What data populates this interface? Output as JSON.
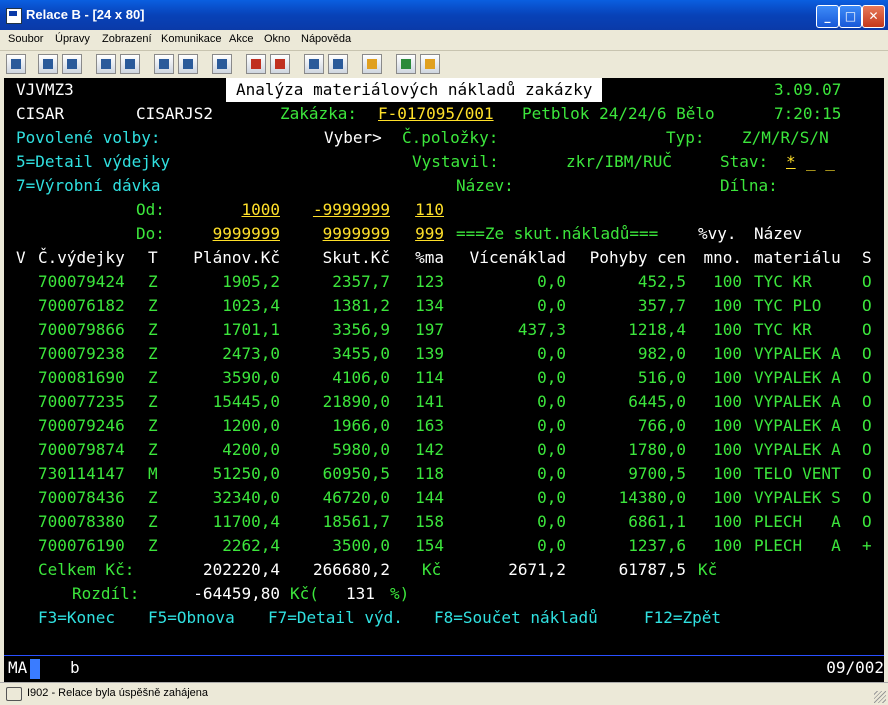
{
  "window": {
    "title": "Relace B - [24 x 80]",
    "minimize": "_",
    "maximize": "□",
    "close": "✕"
  },
  "menu": [
    "Soubor",
    "Úpravy",
    "Zobrazení",
    "Komunikace",
    "Akce",
    "Okno",
    "Nápověda"
  ],
  "toolbar_icons": [
    "print-screen-icon",
    "copy-icon",
    "paste-icon",
    "send-icon",
    "receive-icon",
    "display-icon",
    "keyboard-icon",
    "macro-icon",
    "record-icon",
    "playback-icon",
    "stop-icon",
    "clip-icon",
    "help-globe-icon",
    "customize-icon"
  ],
  "screen": {
    "program": "VJVMZ3",
    "title": "Analýza materiálových nákladů zakázky",
    "date": "3.09.07",
    "user": "CISAR",
    "device": "CISARJS2",
    "order_label": "Zakázka:",
    "order_value": "F-017095/001",
    "order_desc": "Petblok 24/24/6 Bělo",
    "time": "7:20:15",
    "allowed_options": "Povolené volby:",
    "select_label": "Vyber>",
    "item_no_label": "Č.položky:",
    "item_no_value": "",
    "type_label": "Typ:",
    "type_value": "",
    "type_options": "Z/M/R/S/N",
    "option5": "5=Detail výdejky",
    "issuer_label": "Vystavil:",
    "issuer_value": "",
    "issuer_options": "zkr/IBM/RUČ",
    "state_label": "Stav:",
    "state_value": "*",
    "option7": "7=Výrobní dávka",
    "name_label": "Název:",
    "name_value": "",
    "workshop_label": "Dílna:",
    "workshop_value": "",
    "from_label": "Od:",
    "from_plan": "1000",
    "from_actual": "-9999999",
    "from_pct": "110",
    "to_label": "Do:",
    "to_plan": "9999999",
    "to_actual": "9999999",
    "to_pct": "999",
    "actual_costs_note": "===Ze skut.nákladů===",
    "col_pct_header": "%vy.",
    "col_name_header": "Název"
  },
  "table": {
    "headers": [
      "V",
      "Č.výdejky",
      "T",
      "Plánov.Kč",
      "Skut.Kč",
      "%ma",
      "Vícenáklad",
      "Pohyby cen",
      "mno.",
      "materiálu",
      "S"
    ],
    "rows": [
      [
        "",
        "700079424",
        "Z",
        "1905,2",
        "2357,7",
        "123",
        "0,0",
        "452,5",
        "100",
        "TYC KR",
        "O"
      ],
      [
        "",
        "700076182",
        "Z",
        "1023,4",
        "1381,2",
        "134",
        "0,0",
        "357,7",
        "100",
        "TYC PLO",
        "O"
      ],
      [
        "",
        "700079866",
        "Z",
        "1701,1",
        "3356,9",
        "197",
        "437,3",
        "1218,4",
        "100",
        "TYC KR",
        "O"
      ],
      [
        "",
        "700079238",
        "Z",
        "2473,0",
        "3455,0",
        "139",
        "0,0",
        "982,0",
        "100",
        "VYPALEK A",
        "O"
      ],
      [
        "",
        "700081690",
        "Z",
        "3590,0",
        "4106,0",
        "114",
        "0,0",
        "516,0",
        "100",
        "VYPALEK A",
        "O"
      ],
      [
        "",
        "700077235",
        "Z",
        "15445,0",
        "21890,0",
        "141",
        "0,0",
        "6445,0",
        "100",
        "VYPALEK A",
        "O"
      ],
      [
        "",
        "700079246",
        "Z",
        "1200,0",
        "1966,0",
        "163",
        "0,0",
        "766,0",
        "100",
        "VYPALEK A",
        "O"
      ],
      [
        "",
        "700079874",
        "Z",
        "4200,0",
        "5980,0",
        "142",
        "0,0",
        "1780,0",
        "100",
        "VYPALEK A",
        "O"
      ],
      [
        "",
        "730114147",
        "M",
        "51250,0",
        "60950,5",
        "118",
        "0,0",
        "9700,5",
        "100",
        "TELO VENT",
        "O"
      ],
      [
        "",
        "700078436",
        "Z",
        "32340,0",
        "46720,0",
        "144",
        "0,0",
        "14380,0",
        "100",
        "VYPALEK S",
        "O"
      ],
      [
        "",
        "700078380",
        "Z",
        "11700,4",
        "18561,7",
        "158",
        "0,0",
        "6861,1",
        "100",
        "PLECH   A",
        "O"
      ],
      [
        "",
        "700076190",
        "Z",
        "2262,4",
        "3500,0",
        "154",
        "0,0",
        "1237,6",
        "100",
        "PLECH   A",
        "+"
      ]
    ]
  },
  "totals": {
    "label": "Celkem Kč:",
    "plan": "202220,4",
    "actual": "266680,2",
    "currency": "Kč",
    "extra": "2671,2",
    "price_moves": "61787,5",
    "diff_label": "Rozdíl:",
    "diff_value": "-64459,80",
    "diff_pct_prefix": "Kč(",
    "diff_pct": "131",
    "diff_pct_suffix": "%)"
  },
  "fkeys": [
    "F3=Konec",
    "F5=Obnova",
    "F7=Detail výd.",
    "F8=Součet nákladů",
    "F12=Zpět"
  ],
  "oia": {
    "mode": "MA",
    "indicator": "b",
    "cursor_pos": "09/002"
  },
  "statusbar": {
    "message": "I902 - Relace byla úspěšně zahájena"
  }
}
